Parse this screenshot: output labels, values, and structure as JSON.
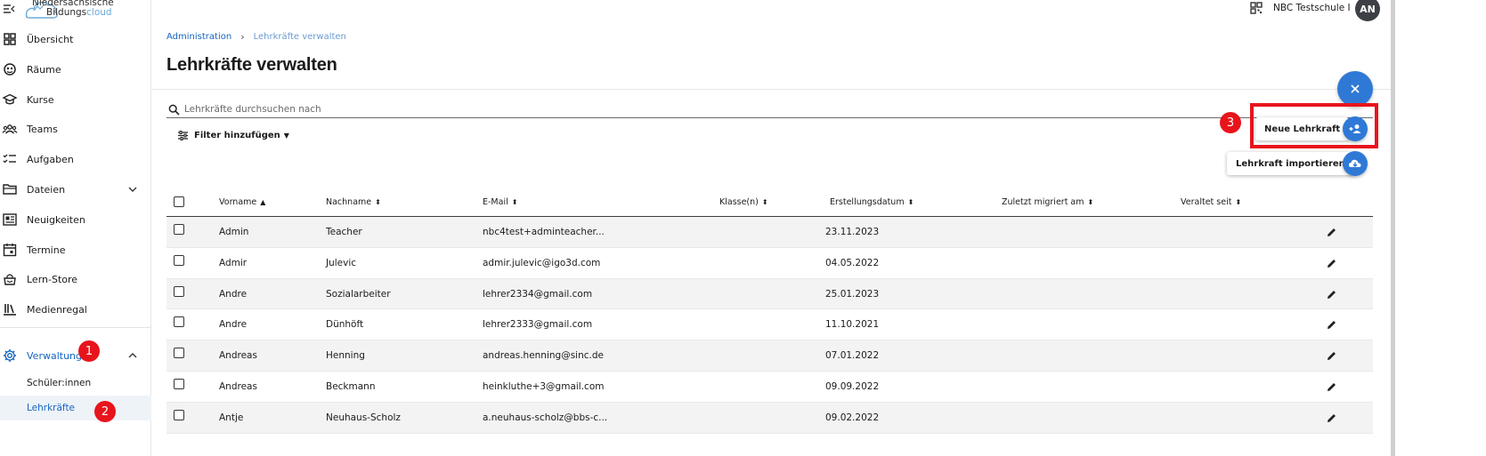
{
  "app": {
    "logo_line1": "Niedersächsische",
    "logo_line2_a": "Bildungs",
    "logo_line2_b": "cloud"
  },
  "sidebar": {
    "items": [
      {
        "label": "Übersicht",
        "icon": "dashboard-icon"
      },
      {
        "label": "Räume",
        "icon": "rooms-icon"
      },
      {
        "label": "Kurse",
        "icon": "school-cap-icon"
      },
      {
        "label": "Teams",
        "icon": "teams-icon"
      },
      {
        "label": "Aufgaben",
        "icon": "tasks-icon"
      },
      {
        "label": "Dateien",
        "icon": "folder-icon"
      },
      {
        "label": "Neuigkeiten",
        "icon": "news-icon"
      },
      {
        "label": "Termine",
        "icon": "calendar-icon"
      },
      {
        "label": "Lern-Store",
        "icon": "learn-store-icon"
      },
      {
        "label": "Medienregal",
        "icon": "media-shelf-icon"
      }
    ],
    "admin": {
      "label": "Verwaltung",
      "icon": "gear-icon"
    },
    "sub_items": [
      {
        "label": "Schüler:innen"
      },
      {
        "label": "Lehrkräfte"
      }
    ]
  },
  "annotations": {
    "badge1": "1",
    "badge2": "2",
    "badge3": "3"
  },
  "header": {
    "school_name": "NBC Testschule I",
    "avatar_initials": "AN"
  },
  "breadcrumb": {
    "root": "Administration",
    "current": "Lehrkräfte verwalten"
  },
  "page_title": "Lehrkräfte verwalten",
  "search": {
    "placeholder": "Lehrkräfte durchsuchen nach",
    "value": ""
  },
  "filter_label": "Filter hinzufügen",
  "fab": {
    "new_label": "Neue Lehrkraft",
    "import_label": "Lehrkraft importieren"
  },
  "table": {
    "headers": [
      "Vorname",
      "Nachname",
      "E-Mail",
      "Klasse(n)",
      "Erstellungsdatum",
      "Zuletzt migriert am",
      "Veraltet seit"
    ],
    "rows": [
      {
        "first": "Admin",
        "last": "Teacher",
        "email": "nbc4test+adminteacher...",
        "classes": "",
        "created": "23.11.2023",
        "migrated": "",
        "outdated": ""
      },
      {
        "first": "Admir",
        "last": "Julevic",
        "email": "admir.julevic@igo3d.com",
        "classes": "",
        "created": "04.05.2022",
        "migrated": "",
        "outdated": ""
      },
      {
        "first": "Andre",
        "last": "Sozialarbeiter",
        "email": "lehrer2334@gmail.com",
        "classes": "",
        "created": "25.01.2023",
        "migrated": "",
        "outdated": ""
      },
      {
        "first": "Andre",
        "last": "Dünhöft",
        "email": "lehrer2333@gmail.com",
        "classes": "",
        "created": "11.10.2021",
        "migrated": "",
        "outdated": ""
      },
      {
        "first": "Andreas",
        "last": "Henning",
        "email": "andreas.henning@sinc.de",
        "classes": "",
        "created": "07.01.2022",
        "migrated": "",
        "outdated": ""
      },
      {
        "first": "Andreas",
        "last": "Beckmann",
        "email": "heinkluthe+3@gmail.com",
        "classes": "",
        "created": "09.09.2022",
        "migrated": "",
        "outdated": ""
      },
      {
        "first": "Antje",
        "last": "Neuhaus-Scholz",
        "email": "a.neuhaus-scholz@bbs-c...",
        "classes": "",
        "created": "09.02.2022",
        "migrated": "",
        "outdated": ""
      }
    ]
  },
  "colors": {
    "accent": "#1565c0",
    "fab": "#2f79d6",
    "highlight": "#e8141c"
  }
}
